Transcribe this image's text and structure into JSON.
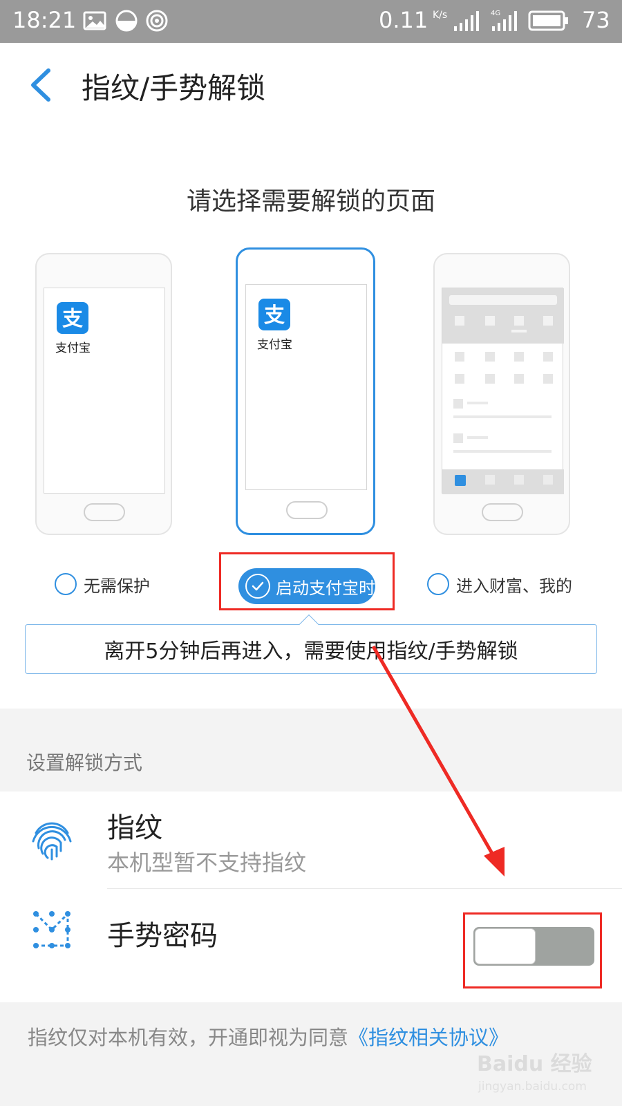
{
  "status_bar": {
    "time": "18:21",
    "network_speed": "0.11",
    "speed_unit": "K/s",
    "battery": "73",
    "icons": [
      "image-icon",
      "clock-icon",
      "location-icon",
      "signal-icon",
      "4g-signal-icon",
      "battery-icon"
    ]
  },
  "header": {
    "back_icon": "chevron-left-icon",
    "title": "指纹/手势解锁"
  },
  "page": {
    "subtitle": "请选择需要解锁的页面"
  },
  "phones": [
    {
      "app_label": "支付宝",
      "logo_text": "支",
      "selected": false
    },
    {
      "app_label": "支付宝",
      "logo_text": "支",
      "selected": true
    },
    {
      "selected": false
    }
  ],
  "options": {
    "none": "无需保护",
    "on_launch": "启动支付宝时",
    "wealth_me": "进入财富、我的",
    "selected": "on_launch"
  },
  "tooltip": {
    "text": "离开5分钟后再进入，需要使用指纹/手势解锁"
  },
  "settings": {
    "section_title": "设置解锁方式",
    "fingerprint": {
      "title": "指纹",
      "subtitle": "本机型暂不支持指纹",
      "icon": "fingerprint-icon"
    },
    "gesture": {
      "title": "手势密码",
      "icon": "gesture-pattern-icon",
      "enabled": false
    }
  },
  "footer": {
    "text": "指纹仅对本机有效，开通即视为同意",
    "link": "《指纹相关协议》"
  },
  "watermark": {
    "main": "Baidu 经验",
    "sub": "jingyan.baidu.com"
  },
  "colors": {
    "accent": "#2f8fe0",
    "annotation_red": "#ee2a24",
    "status_bar": "#9a9a9a",
    "toggle_off": "#9fa3a0"
  }
}
